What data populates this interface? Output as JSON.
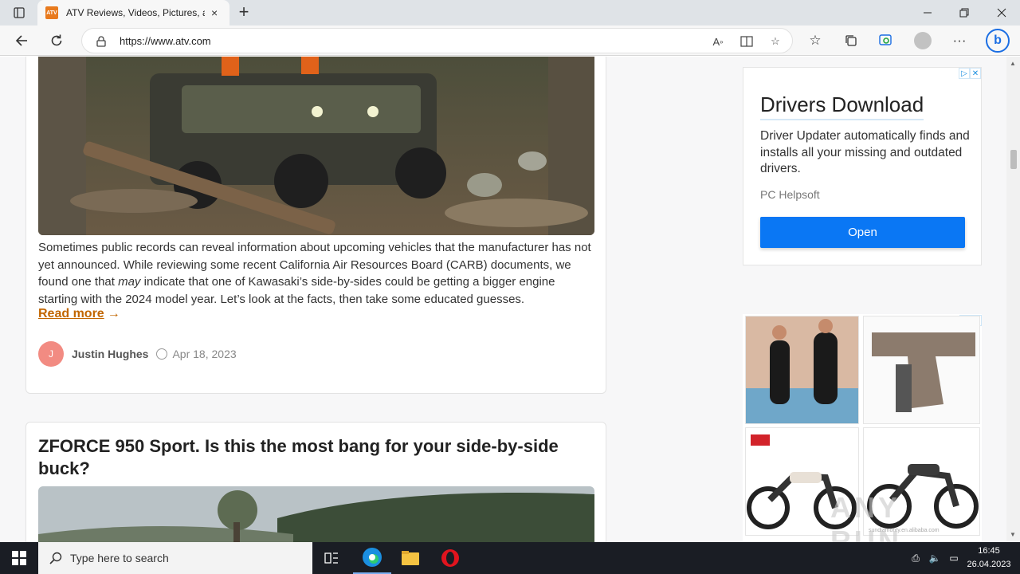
{
  "browser": {
    "tab_title": "ATV Reviews, Videos, Pictures, an",
    "favicon_text": "ATV",
    "url": "https://www.atv.com",
    "new_tab_symbol": "+",
    "tab_close_symbol": "×"
  },
  "article1": {
    "text_before": "Sometimes public records can reveal information about upcoming vehicles that the manufacturer has not yet announced. While reviewing some recent California Air Resources Board (CARB) documents, we found one that ",
    "text_em": "may",
    "text_after": " indicate that one of Kawasaki’s side-by-sides could be getting a bigger engine starting with the 2024 model year. Let’s look at the facts, then take some educated guesses.",
    "read_more": "Read more",
    "read_more_arrow": "→",
    "author_initial": "J",
    "author": "Justin Hughes",
    "date": "Apr 18, 2023"
  },
  "article2": {
    "title": "ZFORCE 950 Sport. Is this the most bang for your side-by-side buck?"
  },
  "ad1": {
    "title": "Drivers Download",
    "description": "Driver Updater automatically finds and installs all your missing and outdated drivers.",
    "brand": "PC Helpsoft",
    "button": "Open",
    "button_color": "#0a77f4"
  },
  "ad2": {
    "watermark": "ANY RUN",
    "tile_caption": "sundiamonty.en.alibaba.com"
  },
  "taskbar": {
    "search_placeholder": "Type here to search",
    "time": "16:45",
    "date": "26.04.2023"
  }
}
